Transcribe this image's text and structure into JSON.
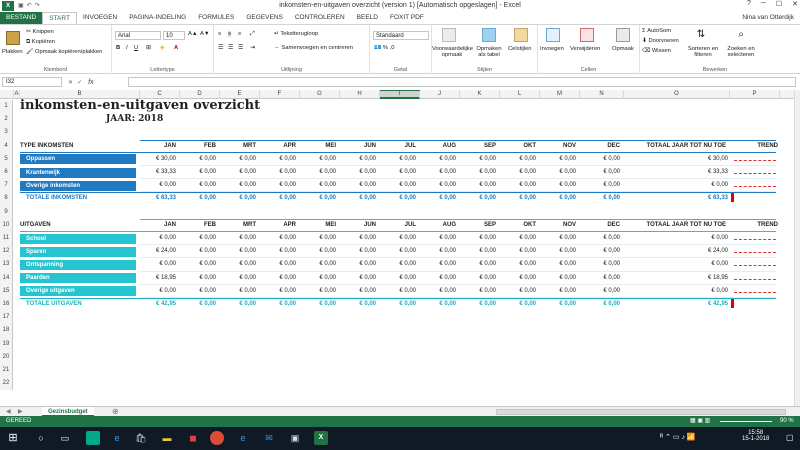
{
  "window": {
    "title": "inkomsten-en-uitgaven overzicht (version 1) [Automatisch opgeslagen] - Excel",
    "user": "Nina van Otterdijk"
  },
  "tabs": [
    "BESTAND",
    "START",
    "INVOEGEN",
    "PAGINA-INDELING",
    "FORMULES",
    "GEGEVENS",
    "CONTROLEREN",
    "BEELD",
    "FOXIT PDF"
  ],
  "ribbon": {
    "clipboard": {
      "paste": "Plakken",
      "cut": "Knippen",
      "copy": "Kopiëren",
      "format_painter": "Opmaak kopiëren/plakken",
      "label": "Klembord"
    },
    "font": {
      "name": "Arial",
      "size": "10",
      "label": "Lettertype"
    },
    "alignment": {
      "wrap": "Tekstterugloop",
      "merge": "Samenvoegen en centreren",
      "label": "Uitlijning"
    },
    "number": {
      "format": "Standaard",
      "label": "Getal"
    },
    "styles": {
      "conditional": "Voorwaardelijke opmaak",
      "as_table": "Opmaken als tabel",
      "cell_styles": "Celstijlen",
      "label": "Stijlen"
    },
    "cells": {
      "insert": "Invoegen",
      "delete": "Verwijderen",
      "format": "Opmaak",
      "label": "Cellen"
    },
    "editing": {
      "autosum": "AutoSom",
      "fill": "Doorvoeren",
      "clear": "Wissen",
      "sort": "Sorteren en filteren",
      "find": "Zoeken en selecteren",
      "label": "Bewerken"
    }
  },
  "formula_bar": {
    "name_box": "I32",
    "fx": "fx",
    "value": ""
  },
  "columns": [
    "A",
    "B",
    "C",
    "D",
    "E",
    "F",
    "G",
    "H",
    "I",
    "J",
    "K",
    "L",
    "M",
    "N",
    "O",
    "P"
  ],
  "rows": [
    "1",
    "2",
    "3",
    "4",
    "5",
    "6",
    "7",
    "8",
    "9",
    "10",
    "11",
    "12",
    "13",
    "14",
    "15",
    "16",
    "17",
    "18",
    "19",
    "20",
    "21",
    "22"
  ],
  "sheet": {
    "title": "inkomsten-en-uitgaven overzicht",
    "year_label": "JAAR: 2018",
    "months": [
      "JAN",
      "FEB",
      "MRT",
      "APR",
      "MEI",
      "JUN",
      "JUL",
      "AUG",
      "SEP",
      "OKT",
      "NOV",
      "DEC"
    ],
    "total_header": "TOTAAL JAAR TOT NU TOE",
    "trend_header": "TREND",
    "income": {
      "header": "TYPE INKOMSTEN",
      "rows": [
        {
          "label": "Oppassen",
          "values": [
            "€ 30,00",
            "€ 0,00",
            "€ 0,00",
            "€ 0,00",
            "€ 0,00",
            "€ 0,00",
            "€ 0,00",
            "€ 0,00",
            "€ 0,00",
            "€ 0,00",
            "€ 0,00",
            "€ 0,00"
          ],
          "total": "€ 30,00"
        },
        {
          "label": "Krantenwijk",
          "values": [
            "€ 33,33",
            "€ 0,00",
            "€ 0,00",
            "€ 0,00",
            "€ 0,00",
            "€ 0,00",
            "€ 0,00",
            "€ 0,00",
            "€ 0,00",
            "€ 0,00",
            "€ 0,00",
            "€ 0,00"
          ],
          "total": "€ 33,33"
        },
        {
          "label": "Overige inkomsten",
          "values": [
            "€ 0,00",
            "€ 0,00",
            "€ 0,00",
            "€ 0,00",
            "€ 0,00",
            "€ 0,00",
            "€ 0,00",
            "€ 0,00",
            "€ 0,00",
            "€ 0,00",
            "€ 0,00",
            "€ 0,00"
          ],
          "total": "€ 0,00"
        }
      ],
      "total_label": "TOTALE INKOMSTEN",
      "totals": [
        "€ 63,33",
        "€ 0,00",
        "€ 0,00",
        "€ 0,00",
        "€ 0,00",
        "€ 0,00",
        "€ 0,00",
        "€ 0,00",
        "€ 0,00",
        "€ 0,00",
        "€ 0,00",
        "€ 0,00"
      ],
      "grand_total": "€ 63,33"
    },
    "expenses": {
      "header": "UITGAVEN",
      "rows": [
        {
          "label": "School",
          "values": [
            "€ 0,00",
            "€ 0,00",
            "€ 0,00",
            "€ 0,00",
            "€ 0,00",
            "€ 0,00",
            "€ 0,00",
            "€ 0,00",
            "€ 0,00",
            "€ 0,00",
            "€ 0,00",
            "€ 0,00"
          ],
          "total": "€ 0,00"
        },
        {
          "label": "Sparen",
          "values": [
            "€ 24,00",
            "€ 0,00",
            "€ 0,00",
            "€ 0,00",
            "€ 0,00",
            "€ 0,00",
            "€ 0,00",
            "€ 0,00",
            "€ 0,00",
            "€ 0,00",
            "€ 0,00",
            "€ 0,00"
          ],
          "total": "€ 24,00"
        },
        {
          "label": "Ontspanning",
          "values": [
            "€ 0,00",
            "€ 0,00",
            "€ 0,00",
            "€ 0,00",
            "€ 0,00",
            "€ 0,00",
            "€ 0,00",
            "€ 0,00",
            "€ 0,00",
            "€ 0,00",
            "€ 0,00",
            "€ 0,00"
          ],
          "total": "€ 0,00"
        },
        {
          "label": "Paarden",
          "values": [
            "€ 18,95",
            "€ 0,00",
            "€ 0,00",
            "€ 0,00",
            "€ 0,00",
            "€ 0,00",
            "€ 0,00",
            "€ 0,00",
            "€ 0,00",
            "€ 0,00",
            "€ 0,00",
            "€ 0,00"
          ],
          "total": "€ 18,95"
        },
        {
          "label": "Overige uitgaven",
          "values": [
            "€ 0,00",
            "€ 0,00",
            "€ 0,00",
            "€ 0,00",
            "€ 0,00",
            "€ 0,00",
            "€ 0,00",
            "€ 0,00",
            "€ 0,00",
            "€ 0,00",
            "€ 0,00",
            "€ 0,00"
          ],
          "total": "€ 0,00"
        }
      ],
      "total_label": "TOTALE UITGAVEN",
      "totals": [
        "€ 42,95",
        "€ 0,00",
        "€ 0,00",
        "€ 0,00",
        "€ 0,00",
        "€ 0,00",
        "€ 0,00",
        "€ 0,00",
        "€ 0,00",
        "€ 0,00",
        "€ 0,00",
        "€ 0,00"
      ],
      "grand_total": "€ 42,95"
    }
  },
  "sheet_tab": "Gezinsbudget",
  "status": {
    "ready": "GEREED",
    "zoom": "90 %"
  },
  "taskbar": {
    "time": "15:58",
    "date": "15-1-2018"
  },
  "colors": {
    "excel_green": "#217346",
    "income_blue": "#1f7ac2",
    "expense_teal": "#26c4d0",
    "total_blue": "#1f7ac2",
    "total_teal": "#1ab0c0",
    "trend_red": "#e03030"
  }
}
